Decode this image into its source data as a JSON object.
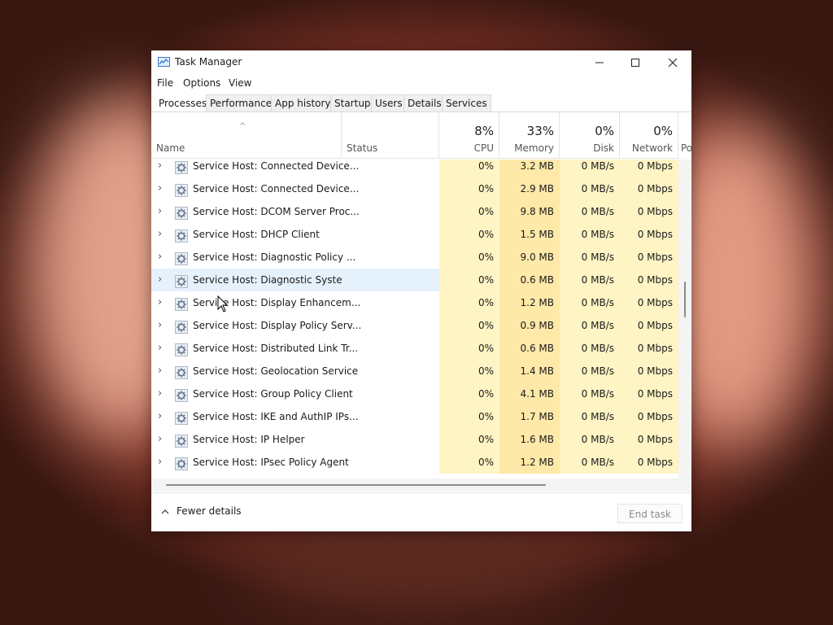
{
  "window": {
    "title": "Task Manager"
  },
  "menu": [
    "File",
    "Options",
    "View"
  ],
  "tabs": [
    "Processes",
    "Performance",
    "App history",
    "Startup",
    "Users",
    "Details",
    "Services"
  ],
  "active_tab": "Processes",
  "columns": {
    "name": "Name",
    "status": "Status",
    "cpu": {
      "pct": "8%",
      "label": "CPU"
    },
    "memory": {
      "pct": "33%",
      "label": "Memory"
    },
    "disk": {
      "pct": "0%",
      "label": "Disk"
    },
    "network": {
      "pct": "0%",
      "label": "Network"
    },
    "power_partial": "Po"
  },
  "rows": [
    {
      "name": "Service Host: Connected Device...",
      "cpu": "0%",
      "memory": "3.2 MB",
      "disk": "0 MB/s",
      "network": "0 Mbps"
    },
    {
      "name": "Service Host: Connected Device...",
      "cpu": "0%",
      "memory": "2.9 MB",
      "disk": "0 MB/s",
      "network": "0 Mbps"
    },
    {
      "name": "Service Host: DCOM Server Proc...",
      "cpu": "0%",
      "memory": "9.8 MB",
      "disk": "0 MB/s",
      "network": "0 Mbps"
    },
    {
      "name": "Service Host: DHCP Client",
      "cpu": "0%",
      "memory": "1.5 MB",
      "disk": "0 MB/s",
      "network": "0 Mbps"
    },
    {
      "name": "Service Host: Diagnostic Policy ...",
      "cpu": "0%",
      "memory": "9.0 MB",
      "disk": "0 MB/s",
      "network": "0 Mbps"
    },
    {
      "name": "Service Host: Diagnostic System...",
      "cpu": "0%",
      "memory": "0.6 MB",
      "disk": "0 MB/s",
      "network": "0 Mbps"
    },
    {
      "name": "Service Host: Display Enhancem...",
      "cpu": "0%",
      "memory": "1.2 MB",
      "disk": "0 MB/s",
      "network": "0 Mbps"
    },
    {
      "name": "Service Host: Display Policy Serv...",
      "cpu": "0%",
      "memory": "0.9 MB",
      "disk": "0 MB/s",
      "network": "0 Mbps"
    },
    {
      "name": "Service Host: Distributed Link Tr...",
      "cpu": "0%",
      "memory": "0.6 MB",
      "disk": "0 MB/s",
      "network": "0 Mbps"
    },
    {
      "name": "Service Host: Geolocation Service",
      "cpu": "0%",
      "memory": "1.4 MB",
      "disk": "0 MB/s",
      "network": "0 Mbps"
    },
    {
      "name": "Service Host: Group Policy Client",
      "cpu": "0%",
      "memory": "4.1 MB",
      "disk": "0 MB/s",
      "network": "0 Mbps"
    },
    {
      "name": "Service Host: IKE and AuthIP IPs...",
      "cpu": "0%",
      "memory": "1.7 MB",
      "disk": "0 MB/s",
      "network": "0 Mbps"
    },
    {
      "name": "Service Host: IP Helper",
      "cpu": "0%",
      "memory": "1.6 MB",
      "disk": "0 MB/s",
      "network": "0 Mbps"
    },
    {
      "name": "Service Host: IPsec Policy Agent",
      "cpu": "0%",
      "memory": "1.2 MB",
      "disk": "0 MB/s",
      "network": "0 Mbps"
    }
  ],
  "hover_row_index": 5,
  "footer": {
    "fewer_details": "Fewer details",
    "end_task": "End task"
  },
  "icons": {
    "app": "task-manager-icon",
    "minimize": "minimize-icon",
    "maximize": "maximize-icon",
    "close": "close-icon",
    "process": "gear-icon",
    "expand": "chevron-right-icon"
  },
  "colors": {
    "heat_light": "#fff4c4",
    "heat_medium": "#ffe9a8",
    "hover": "#e5f1fb"
  }
}
